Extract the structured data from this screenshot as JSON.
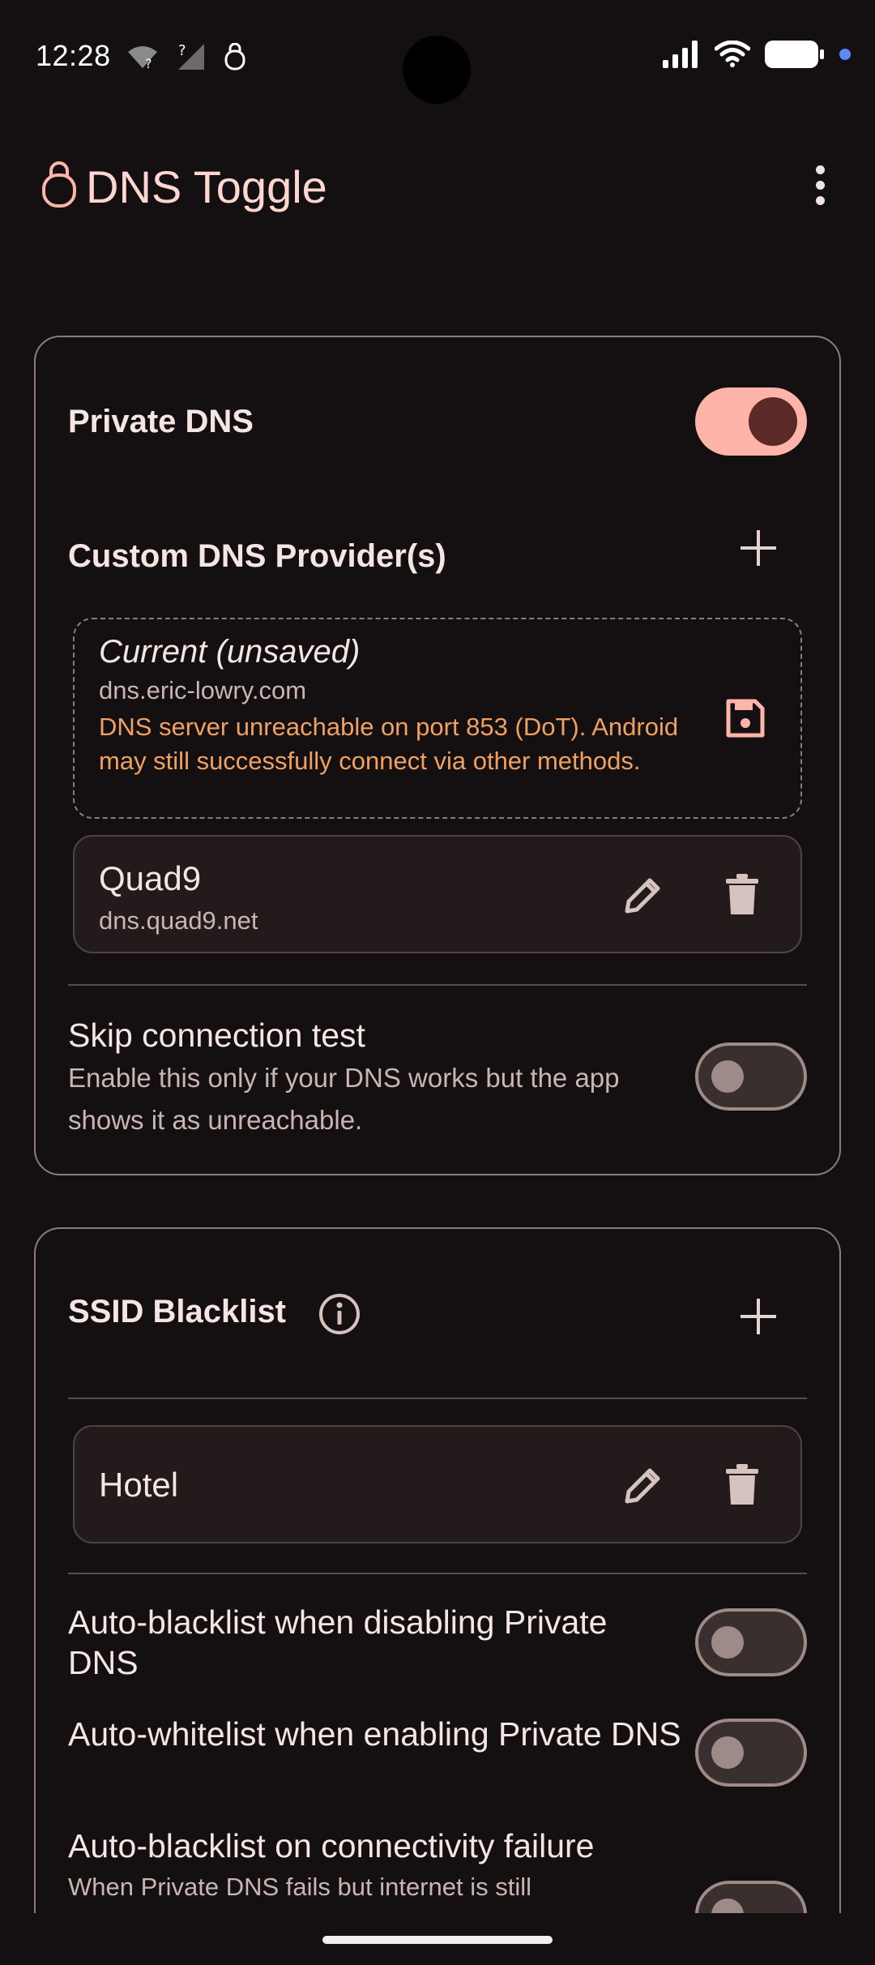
{
  "status_bar": {
    "time": "12:28",
    "left_icons": [
      "wifi-question-icon",
      "signal-question-icon",
      "app-lock-icon"
    ],
    "right_icons": [
      "signal-icon",
      "wifi-icon",
      "battery-icon",
      "notification-dot-icon"
    ]
  },
  "app_bar": {
    "title": "DNS Toggle",
    "logo_icon": "shield-lock-icon",
    "menu_icon": "more-vert-icon",
    "accent": "#ffd6d0"
  },
  "private_dns": {
    "label": "Private DNS",
    "enabled": true
  },
  "custom_dns": {
    "header": "Custom DNS Provider(s)",
    "add_icon": "plus-icon",
    "current": {
      "title": "Current (unsaved)",
      "host": "dns.eric-lowry.com",
      "warning": "DNS server unreachable on port 853 (DoT). Android may still successfully connect via other methods.",
      "warning_color": "#f0a060",
      "save_icon": "save-icon"
    },
    "providers": [
      {
        "name": "Quad9",
        "host": "dns.quad9.net"
      }
    ]
  },
  "skip_test": {
    "title": "Skip connection test",
    "subtitle": "Enable this only if your DNS works but the app shows it as unreachable.",
    "enabled": false
  },
  "ssid_blacklist": {
    "header": "SSID Blacklist",
    "info_icon": "info-icon",
    "add_icon": "plus-icon",
    "items": [
      {
        "name": "Hotel"
      }
    ]
  },
  "auto_options": [
    {
      "title": "Auto-blacklist when disabling Private DNS",
      "enabled": false
    },
    {
      "title": "Auto-whitelist when enabling Private DNS",
      "enabled": false
    },
    {
      "title": "Auto-blacklist on connectivity failure",
      "subtitle": "When Private DNS fails but internet is still",
      "enabled": false
    }
  ]
}
